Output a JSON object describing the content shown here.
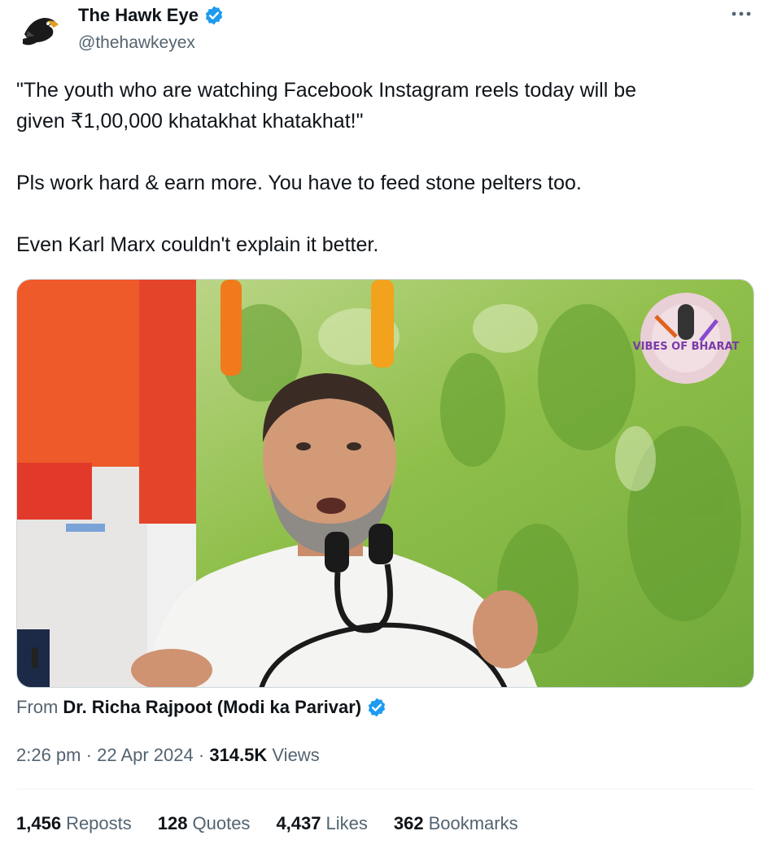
{
  "author": {
    "display_name": "The Hawk Eye",
    "handle": "@thehawkeyex",
    "avatar_icon": "hawk-logo-icon",
    "verified_icon": "verified-badge-icon"
  },
  "more_icon": "more-options-icon",
  "tweet": {
    "line1": "\"The youth who are watching Facebook Instagram reels today will be",
    "line2": "given ₹1,00,000 khatakhat khatakhat!\"",
    "line3": "Pls work hard & earn more. You have to feed stone pelters too.",
    "line4": "Even Karl Marx couldn't explain it better."
  },
  "media": {
    "watermark_text": "VIBES OF BHARAT"
  },
  "source": {
    "prefix": "From",
    "name": "Dr. Richa Rajpoot (Modi ka Parivar)"
  },
  "meta": {
    "time": "2:26 pm",
    "sep1": "·",
    "date": "22 Apr 2024",
    "sep2": "·",
    "views_count": "314.5K",
    "views_label": "Views"
  },
  "stats": [
    {
      "count": "1,456",
      "label": "Reposts"
    },
    {
      "count": "128",
      "label": "Quotes"
    },
    {
      "count": "4,437",
      "label": "Likes"
    },
    {
      "count": "362",
      "label": "Bookmarks"
    }
  ],
  "colors": {
    "verified": "#1d9bf0",
    "muted": "#536471",
    "text": "#0f1419"
  }
}
